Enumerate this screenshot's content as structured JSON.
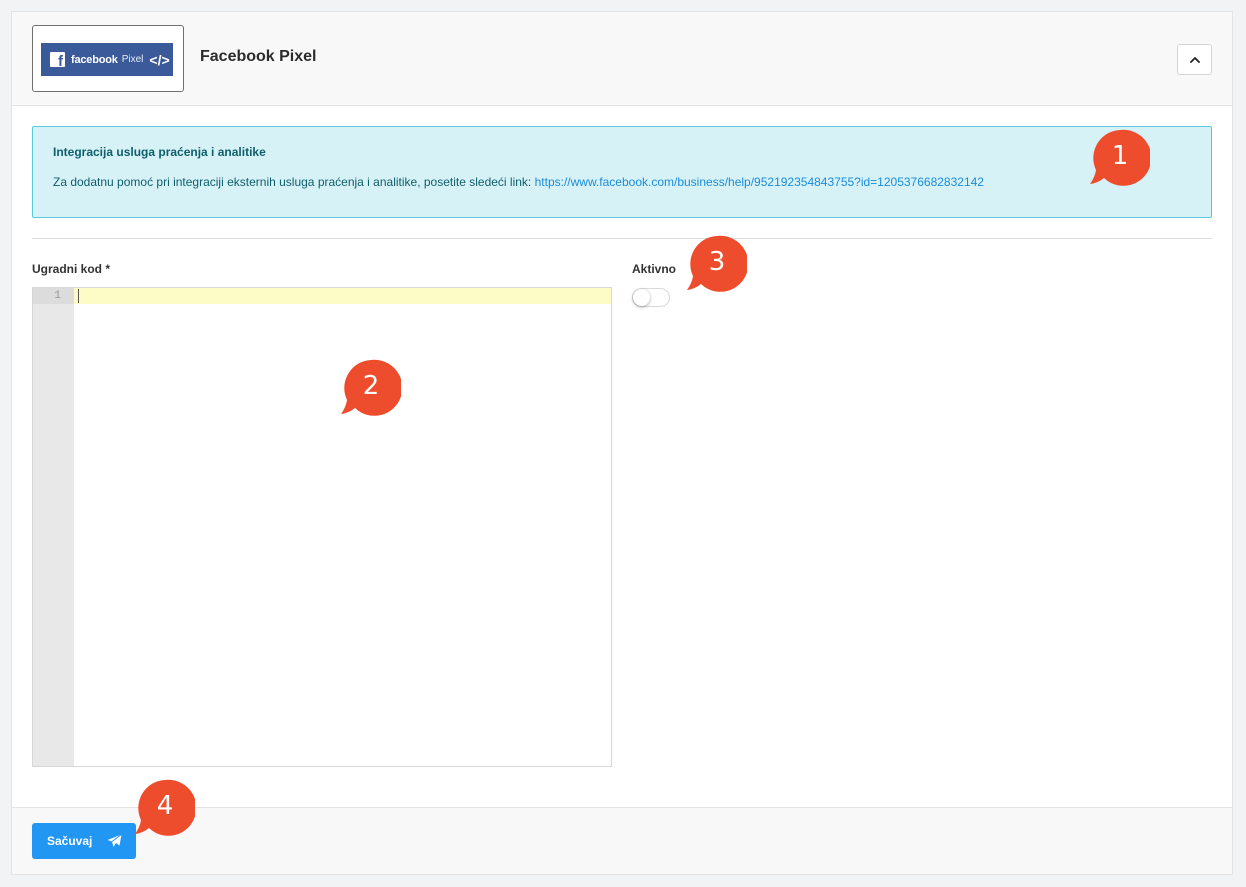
{
  "header": {
    "logo": {
      "brand_word": "facebook",
      "product_word": "Pixel",
      "code_glyph": "</>",
      "brand_color": "#3b5a9a"
    },
    "title": "Facebook Pixel",
    "collapse_icon": "chevron-up-icon"
  },
  "alert": {
    "title": "Integracija usluga praćenja i analitike",
    "text": "Za dodatnu pomoć pri integraciji eksternih usluga praćenja i analitike, posetite sledeći link: ",
    "link": "https://www.facebook.com/business/help/952192354843755?id=1205376682832142",
    "bg_color": "#d7f2f7",
    "border_color": "#5ccbd9"
  },
  "form": {
    "embed_code_label": "Ugradni kod *",
    "embed_code_line_number": "1",
    "embed_code_value": "",
    "active_label": "Aktivno",
    "active_value": false
  },
  "footer": {
    "save_label": "Sačuvaj",
    "save_icon": "paper-plane-icon",
    "save_color": "#2196f3"
  },
  "callouts": [
    "1",
    "2",
    "3",
    "4"
  ],
  "callout_color": "#ee4d2d"
}
